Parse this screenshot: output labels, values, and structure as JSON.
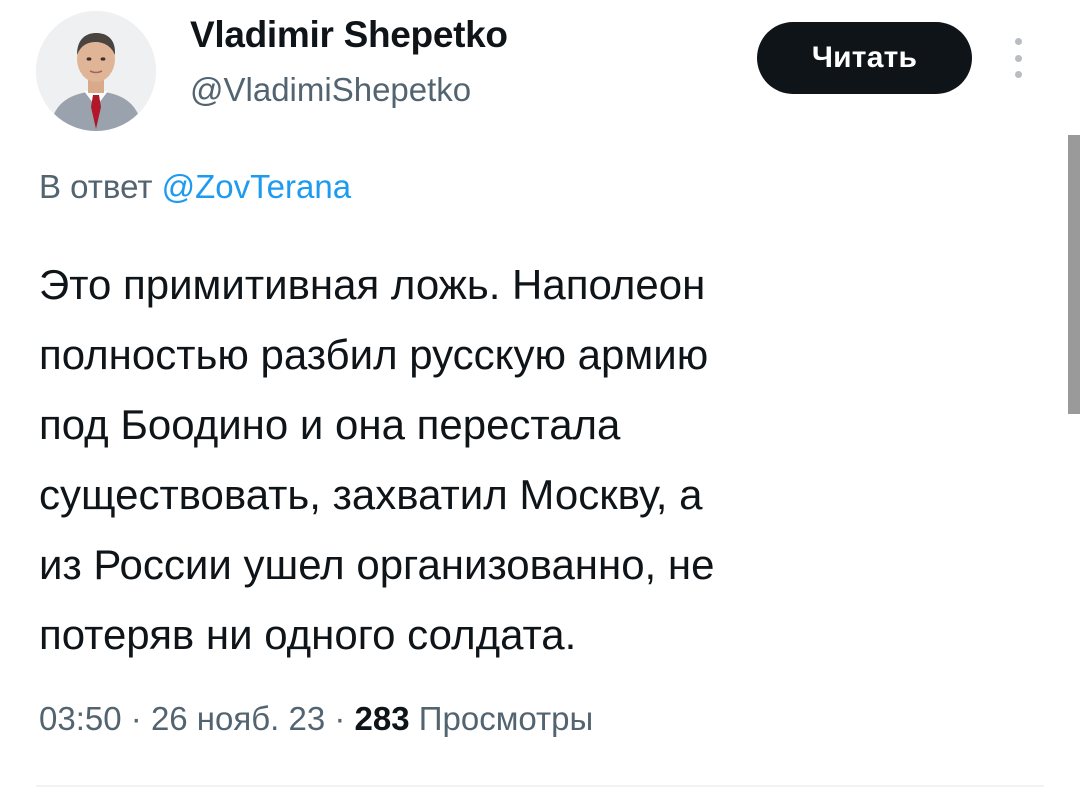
{
  "author": {
    "display_name": "Vladimir Shepetko",
    "handle": "@VladimiShepetko"
  },
  "follow_button": {
    "label": "Читать"
  },
  "reply_context": {
    "prefix": "В ответ",
    "mention": "@ZovTerana"
  },
  "tweet": {
    "text_lines": [
      "Это примитивная ложь. Наполеон",
      "полностью разбил русскую армию",
      "под Боодино и она перестала",
      "существовать, захватил Москву, а",
      "из России ушел организованно, не",
      "потеряв ни одного солдата."
    ]
  },
  "meta": {
    "time": "03:50",
    "separator": "·",
    "date": "26 нояб. 23",
    "views_count": "283",
    "views_label": "Просмотры"
  },
  "icons": {
    "more": "more-vertical-icon"
  },
  "colors": {
    "text_primary": "#0f1419",
    "text_secondary": "#536471",
    "link": "#1d9bf0",
    "button_bg": "#0f1419",
    "button_text": "#ffffff"
  }
}
